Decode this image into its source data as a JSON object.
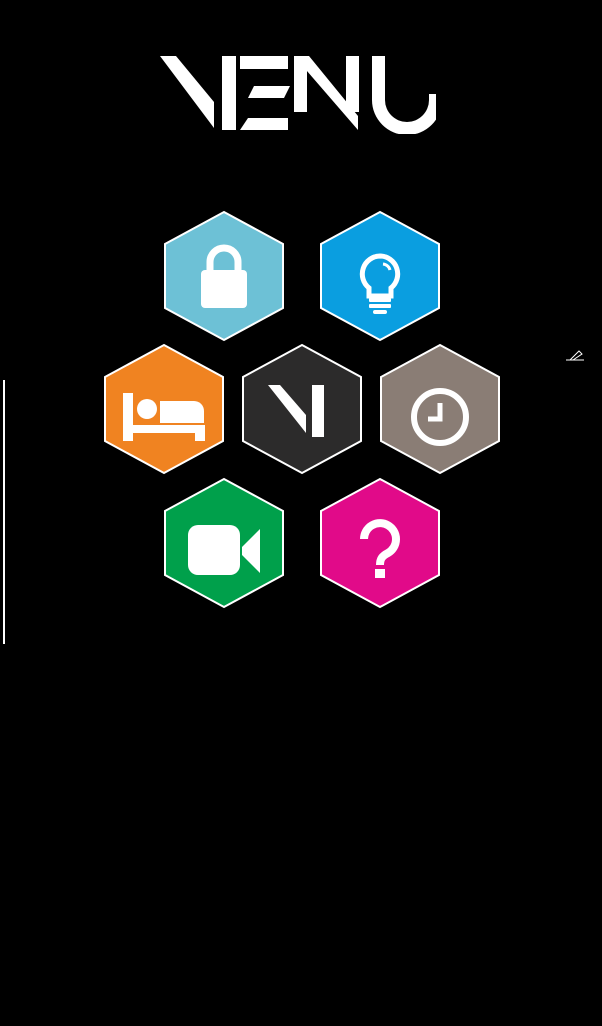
{
  "header": {
    "title": "MENU"
  },
  "menu": {
    "items": [
      {
        "id": "lock",
        "icon": "lock-icon",
        "color": "#6dc1d6"
      },
      {
        "id": "lighting",
        "icon": "lightbulb-icon",
        "color": "#0a9ee0"
      },
      {
        "id": "bed",
        "icon": "bed-icon",
        "color": "#f08321"
      },
      {
        "id": "home",
        "icon": "m-logo-icon",
        "color": "#2c2b2b"
      },
      {
        "id": "clock",
        "icon": "clock-icon",
        "color": "#8a7d75"
      },
      {
        "id": "video",
        "icon": "video-camera-icon",
        "color": "#00a04b"
      },
      {
        "id": "help",
        "icon": "question-mark-icon",
        "color": "#e10a89"
      }
    ]
  },
  "colors": {
    "background": "#000000",
    "hex_border": "#ffffff",
    "icon": "#ffffff"
  }
}
